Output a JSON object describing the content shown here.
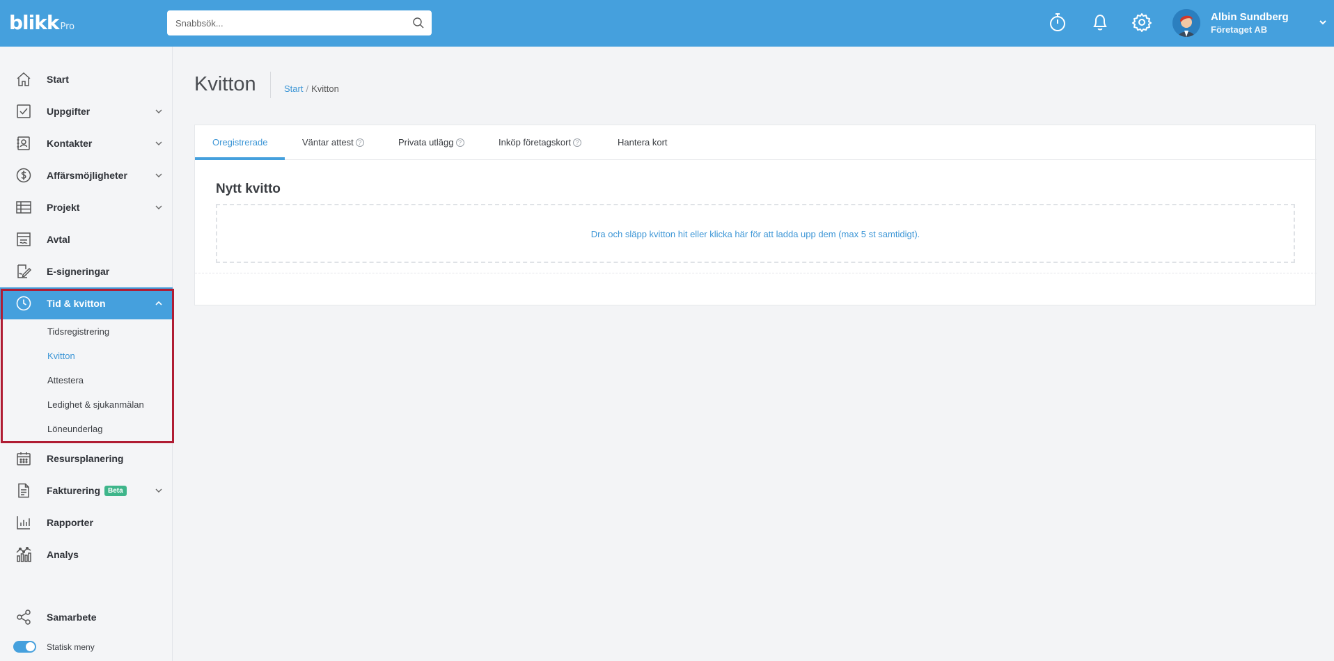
{
  "header": {
    "logo_text": "blikk",
    "logo_sub": "Pro",
    "search_placeholder": "Snabbsök...",
    "user_name": "Albin Sundberg",
    "user_company": "Företaget AB",
    "icons": [
      "stopwatch-icon",
      "bell-icon",
      "gear-icon"
    ]
  },
  "sidebar": {
    "items": [
      {
        "label": "Start",
        "icon": "home-icon",
        "chevron": false
      },
      {
        "label": "Uppgifter",
        "icon": "checkbox-icon",
        "chevron": true
      },
      {
        "label": "Kontakter",
        "icon": "contact-book-icon",
        "chevron": true
      },
      {
        "label": "Affärsmöjligheter",
        "icon": "dollar-circle-icon",
        "chevron": true
      },
      {
        "label": "Projekt",
        "icon": "table-icon",
        "chevron": true
      },
      {
        "label": "Avtal",
        "icon": "contract-icon",
        "chevron": false
      },
      {
        "label": "E-signeringar",
        "icon": "signature-icon",
        "chevron": false
      },
      {
        "label": "Tid & kvitton",
        "icon": "clock-icon",
        "chevron": true,
        "active": true
      }
    ],
    "sub_items": [
      "Tidsregistrering",
      "Kvitton",
      "Attestera",
      "Ledighet & sjukanmälan",
      "Löneunderlag"
    ],
    "current_sub": "Kvitton",
    "items_after": [
      {
        "label": "Resursplanering",
        "icon": "calendar-icon",
        "chevron": false
      },
      {
        "label": "Fakturering",
        "icon": "invoice-icon",
        "chevron": true,
        "badge": "Beta"
      },
      {
        "label": "Rapporter",
        "icon": "bar-chart-icon",
        "chevron": false
      },
      {
        "label": "Analys",
        "icon": "analytics-icon",
        "chevron": false
      }
    ],
    "collab_label": "Samarbete",
    "toggle_label": "Statisk meny",
    "toggle_on": true
  },
  "page": {
    "title": "Kvitton",
    "breadcrumb": {
      "home": "Start",
      "separator": "/",
      "current": "Kvitton"
    },
    "tabs": [
      {
        "label": "Oregistrerade",
        "help": false,
        "active": true
      },
      {
        "label": "Väntar attest",
        "help": true
      },
      {
        "label": "Privata utlägg",
        "help": true
      },
      {
        "label": "Inköp företagskort",
        "help": true
      },
      {
        "label": "Hantera kort",
        "help": false
      }
    ],
    "help_glyph": "?",
    "card_heading": "Nytt kvitto",
    "dropzone_text": "Dra och släpp kvitton hit eller klicka här för att ladda upp dem (max 5 st samtidigt)."
  },
  "colors": {
    "brand": "#45a0dd",
    "link": "#3d96d6",
    "highlight": "#b01c33",
    "beta": "#3eb58a"
  }
}
